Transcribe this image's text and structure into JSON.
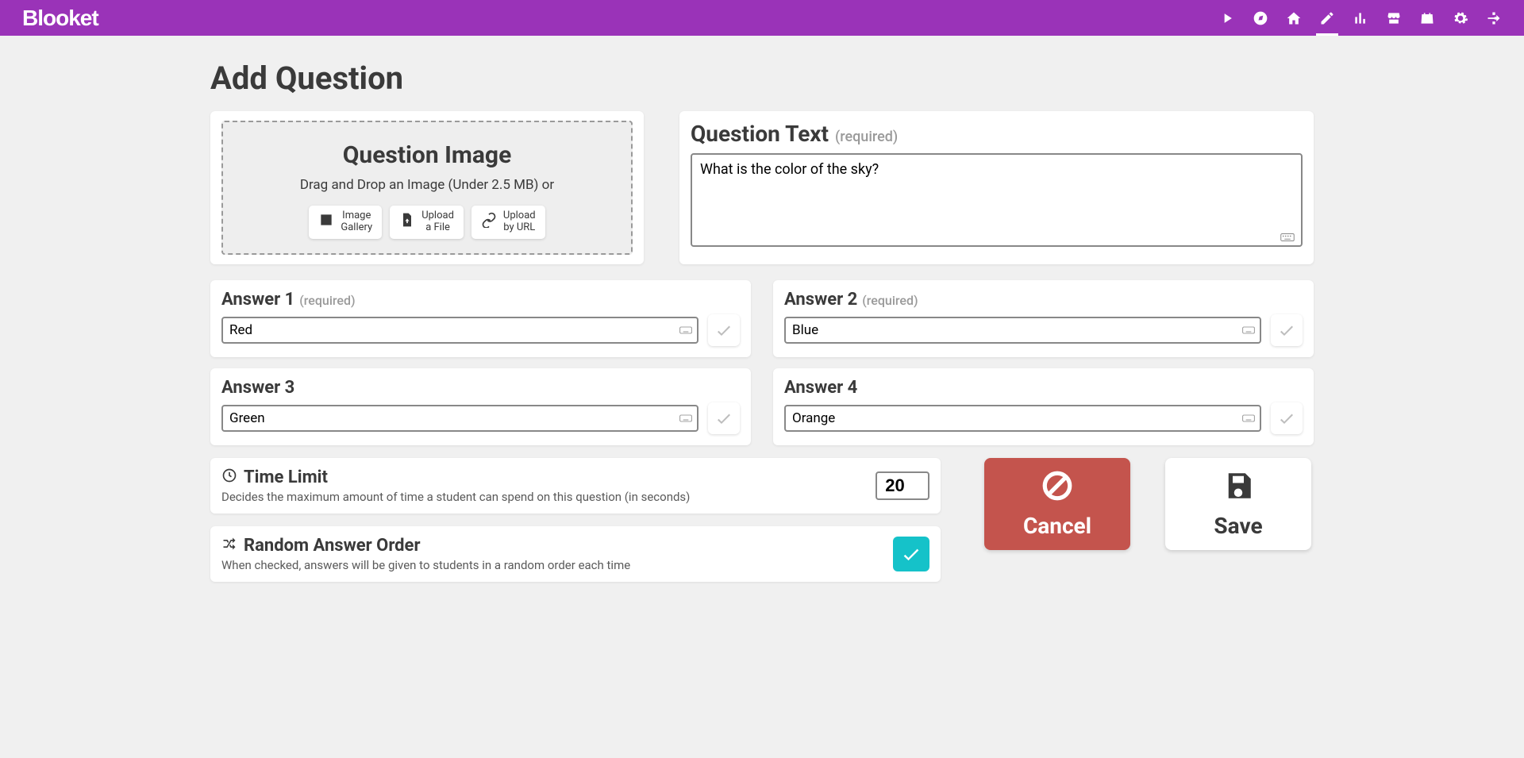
{
  "brand": "Blooket",
  "page_title": "Add Question",
  "question_image": {
    "title": "Question Image",
    "hint": "Drag and Drop an Image (Under 2.5 MB) or",
    "buttons": {
      "gallery": "Image\nGallery",
      "upload_file": "Upload\na File",
      "upload_url": "Upload\nby URL"
    }
  },
  "question_text": {
    "label": "Question Text",
    "required": "(required)",
    "value": "What is the color of the sky?"
  },
  "answers": [
    {
      "label": "Answer 1",
      "required": "(required)",
      "value": "Red"
    },
    {
      "label": "Answer 2",
      "required": "(required)",
      "value": "Blue"
    },
    {
      "label": "Answer 3",
      "required": "",
      "value": "Green"
    },
    {
      "label": "Answer 4",
      "required": "",
      "value": "Orange"
    }
  ],
  "time_limit": {
    "title": "Time Limit",
    "desc": "Decides the maximum amount of time a student can spend on this question (in seconds)",
    "value": "20"
  },
  "random_order": {
    "title": "Random Answer Order",
    "desc": "When checked, answers will be given to students in a random order each time",
    "checked": true
  },
  "actions": {
    "cancel": "Cancel",
    "save": "Save"
  }
}
